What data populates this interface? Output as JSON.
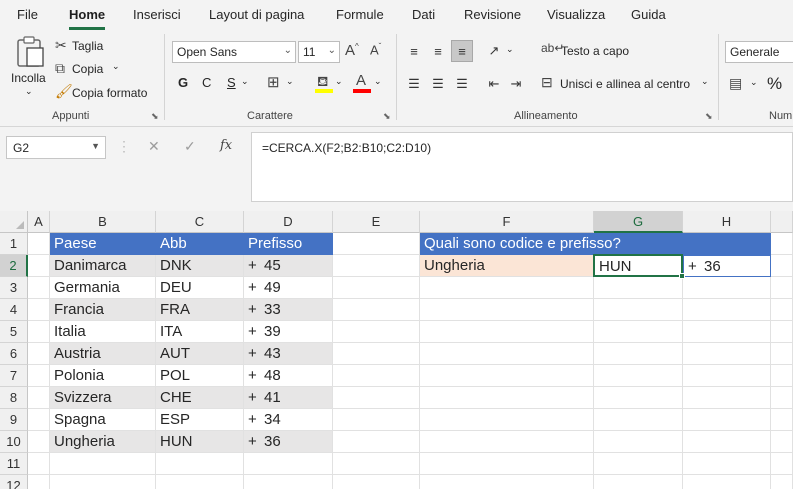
{
  "menu": {
    "tabs": [
      "File",
      "Home",
      "Inserisci",
      "Layout di pagina",
      "Formule",
      "Dati",
      "Revisione",
      "Visualizza",
      "Guida"
    ],
    "active": "Home"
  },
  "ribbon": {
    "clipboard": {
      "paste_label": "Incolla",
      "cut_label": "Taglia",
      "copy_label": "Copia",
      "format_painter_label": "Copia formato",
      "group_label": "Appunti"
    },
    "font": {
      "font_name": "Open Sans",
      "font_size": "11",
      "bold": "G",
      "italic": "C",
      "underline": "S",
      "group_label": "Carattere"
    },
    "alignment": {
      "wrap_text_label": "Testo a capo",
      "merge_label": "Unisci e allinea al centro",
      "group_label": "Allineamento"
    },
    "number": {
      "format": "Generale",
      "percent": "%",
      "group_label": "Num"
    }
  },
  "formula_bar": {
    "name_box": "G2",
    "formula": "=CERCA.X(F2;B2:B10;C2:D10)",
    "fx": "fx"
  },
  "sheet": {
    "columns": [
      "A",
      "B",
      "C",
      "D",
      "E",
      "F",
      "G",
      "H"
    ],
    "rows": [
      "1",
      "2",
      "3",
      "4",
      "5",
      "6",
      "7",
      "8",
      "9",
      "10",
      "11",
      "12"
    ],
    "table_headers": [
      "Paese",
      "Abb",
      "Prefisso"
    ],
    "table_rows": [
      {
        "paese": "Danimarca",
        "abb": "DNK",
        "plus": "+",
        "num": "45"
      },
      {
        "paese": "Germania",
        "abb": "DEU",
        "plus": "+",
        "num": "49"
      },
      {
        "paese": "Francia",
        "abb": "FRA",
        "plus": "+",
        "num": "33"
      },
      {
        "paese": "Italia",
        "abb": "ITA",
        "plus": "+",
        "num": "39"
      },
      {
        "paese": "Austria",
        "abb": "AUT",
        "plus": "+",
        "num": "43"
      },
      {
        "paese": "Polonia",
        "abb": "POL",
        "plus": "+",
        "num": "48"
      },
      {
        "paese": "Svizzera",
        "abb": "CHE",
        "plus": "+",
        "num": "41"
      },
      {
        "paese": "Spagna",
        "abb": "ESP",
        "plus": "+",
        "num": "34"
      },
      {
        "paese": "Ungheria",
        "abb": "HUN",
        "plus": "+",
        "num": "36"
      }
    ],
    "lookup": {
      "question": "Quali sono codice e prefisso?",
      "input": "Ungheria",
      "result_abb": "HUN",
      "result_plus": "+",
      "result_num": "36"
    },
    "selected_cell": "G2"
  },
  "colors": {
    "accent": "#217346",
    "header_blue": "#4472c4",
    "band_gray": "#e7e6e6",
    "peach": "#fbe5d6",
    "highlight_yellow": "#ffff00",
    "font_red": "#ff0000"
  }
}
